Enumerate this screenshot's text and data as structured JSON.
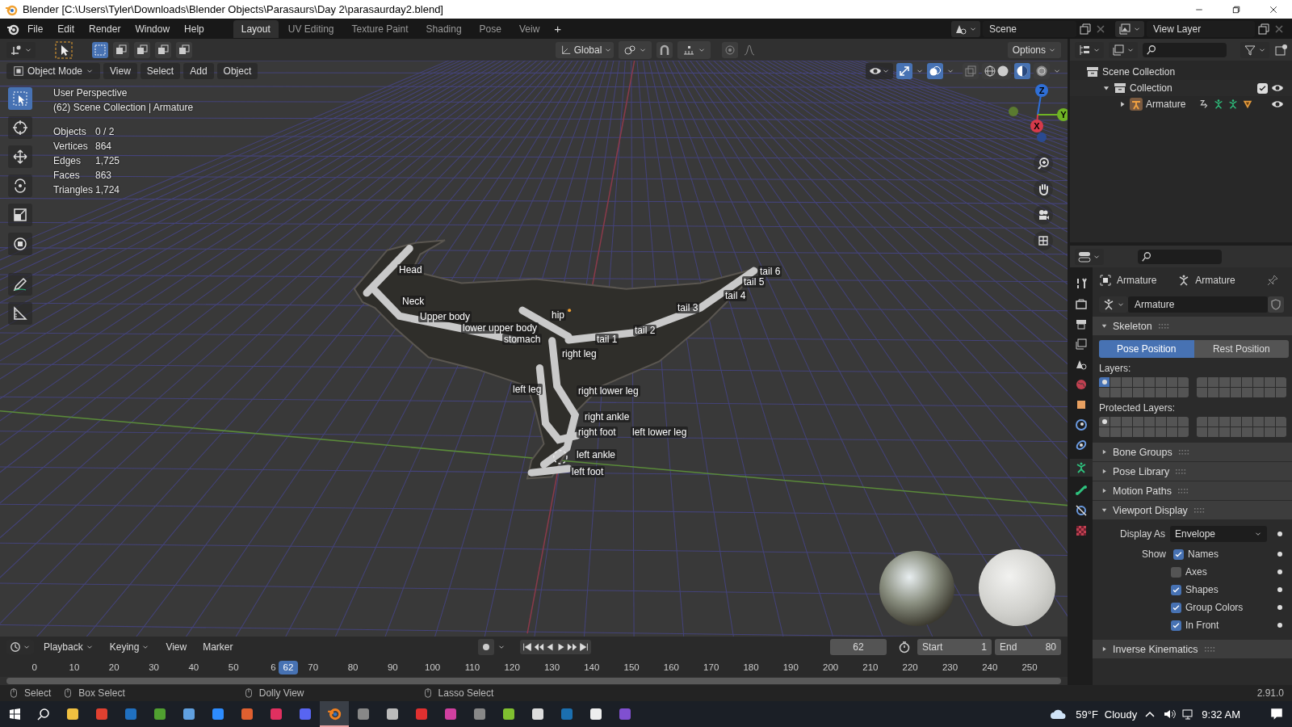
{
  "window": {
    "title": "Blender [C:\\Users\\Tyler\\Downloads\\Blender Objects\\Parasaurs\\Day 2\\parasaurday2.blend]"
  },
  "menu": [
    "File",
    "Edit",
    "Render",
    "Window",
    "Help"
  ],
  "workspaces": [
    {
      "label": "Layout",
      "selected": true
    },
    {
      "label": "UV Editing",
      "selected": false
    },
    {
      "label": "Texture Paint",
      "selected": false
    },
    {
      "label": "Shading",
      "selected": false
    },
    {
      "label": "Pose",
      "selected": false
    },
    {
      "label": "Veiw",
      "selected": false
    }
  ],
  "add_workspace": "+",
  "scene": "Scene",
  "view_layer": "View Layer",
  "viewport": {
    "orientation": "Global",
    "options": "Options",
    "mode": "Object Mode",
    "menus": [
      "View",
      "Select",
      "Add",
      "Object"
    ],
    "info": [
      "User Perspective",
      "(62) Scene Collection | Armature"
    ],
    "stats": [
      {
        "label": "Objects",
        "value": "0 / 2"
      },
      {
        "label": "Vertices",
        "value": "864"
      },
      {
        "label": "Edges",
        "value": "1,725"
      },
      {
        "label": "Faces",
        "value": "863"
      },
      {
        "label": "Triangles",
        "value": "1,724"
      }
    ],
    "gizmo_axes": [
      {
        "label": "Z",
        "color": "#2f6fd6"
      },
      {
        "label": "Y",
        "color": "#6fb324"
      },
      {
        "label": "X",
        "color": "#d63a4a"
      }
    ],
    "bones": [
      {
        "name": "Head"
      },
      {
        "name": "Neck"
      },
      {
        "name": "Upper body"
      },
      {
        "name": "lower upper body"
      },
      {
        "name": "stomach"
      },
      {
        "name": "hip"
      },
      {
        "name": "tail 1"
      },
      {
        "name": "tail 2"
      },
      {
        "name": "tail 3"
      },
      {
        "name": "tail 4"
      },
      {
        "name": "tail 5"
      },
      {
        "name": "tail 6"
      },
      {
        "name": "right leg"
      },
      {
        "name": "left leg"
      },
      {
        "name": "right lower leg"
      },
      {
        "name": "right ankle"
      },
      {
        "name": "right foot"
      },
      {
        "name": "left lower leg"
      },
      {
        "name": "left ankle"
      },
      {
        "name": "left foot"
      }
    ]
  },
  "timeline": {
    "menus": [
      "Playback",
      "Keying",
      "View",
      "Marker"
    ],
    "current_frame": "62",
    "playhead_frame": "62",
    "start_label": "Start",
    "start": "1",
    "end_label": "End",
    "end": "80",
    "ticks": [
      "0",
      "10",
      "20",
      "30",
      "40",
      "50",
      "6",
      "70",
      "80",
      "90",
      "100",
      "110",
      "120",
      "130",
      "140",
      "150",
      "160",
      "170",
      "180",
      "190",
      "200",
      "210",
      "220",
      "230",
      "240",
      "250"
    ]
  },
  "outliner": {
    "items": [
      {
        "label": "Scene Collection",
        "children": [
          {
            "label": "Collection",
            "expanded": true,
            "checked": true,
            "children": [
              {
                "label": "Armature",
                "expanded": false
              }
            ]
          }
        ]
      }
    ]
  },
  "properties": {
    "breadcrumb": [
      "Armature",
      "Armature"
    ],
    "data_name": "Armature",
    "panels": [
      {
        "kind": "skeleton",
        "title": "Skeleton",
        "expanded": true,
        "positions": [
          {
            "label": "Pose Position",
            "selected": true
          },
          {
            "label": "Rest Position",
            "selected": false
          }
        ],
        "layers_label": "Layers:",
        "layers": [
          {
            "selected": true,
            "has_bones": true
          },
          {
            "selected": false,
            "has_bones": false
          },
          {
            "selected": false,
            "has_bones": false
          },
          {
            "selected": false,
            "has_bones": false
          },
          {
            "selected": false,
            "has_bones": false
          },
          {
            "selected": false,
            "has_bones": false
          },
          {
            "selected": false,
            "has_bones": false
          },
          {
            "selected": false,
            "has_bones": false
          },
          {
            "selected": false,
            "has_bones": false
          },
          {
            "selected": false,
            "has_bones": false
          },
          {
            "selected": false,
            "has_bones": false
          },
          {
            "selected": false,
            "has_bones": false
          },
          {
            "selected": false,
            "has_bones": false
          },
          {
            "selected": false,
            "has_bones": false
          },
          {
            "selected": false,
            "has_bones": false
          },
          {
            "selected": false,
            "has_bones": false
          },
          {
            "selected": false,
            "has_bones": false
          },
          {
            "selected": false,
            "has_bones": false
          },
          {
            "selected": false,
            "has_bones": false
          },
          {
            "selected": false,
            "has_bones": false
          },
          {
            "selected": false,
            "has_bones": false
          },
          {
            "selected": false,
            "has_bones": false
          },
          {
            "selected": false,
            "has_bones": false
          },
          {
            "selected": false,
            "has_bones": false
          },
          {
            "selected": false,
            "has_bones": false
          },
          {
            "selected": false,
            "has_bones": false
          },
          {
            "selected": false,
            "has_bones": false
          },
          {
            "selected": false,
            "has_bones": false
          },
          {
            "selected": false,
            "has_bones": false
          },
          {
            "selected": false,
            "has_bones": false
          },
          {
            "selected": false,
            "has_bones": false
          },
          {
            "selected": false,
            "has_bones": false
          }
        ],
        "protected_label": "Protected Layers:",
        "protected_layers": [
          {
            "selected": false,
            "has_bones": true
          },
          {
            "selected": false,
            "has_bones": false
          },
          {
            "selected": false,
            "has_bones": false
          },
          {
            "selected": false,
            "has_bones": false
          },
          {
            "selected": false,
            "has_bones": false
          },
          {
            "selected": false,
            "has_bones": false
          },
          {
            "selected": false,
            "has_bones": false
          },
          {
            "selected": false,
            "has_bones": false
          },
          {
            "selected": false,
            "has_bones": false
          },
          {
            "selected": false,
            "has_bones": false
          },
          {
            "selected": false,
            "has_bones": false
          },
          {
            "selected": false,
            "has_bones": false
          },
          {
            "selected": false,
            "has_bones": false
          },
          {
            "selected": false,
            "has_bones": false
          },
          {
            "selected": false,
            "has_bones": false
          },
          {
            "selected": false,
            "has_bones": false
          },
          {
            "selected": false,
            "has_bones": false
          },
          {
            "selected": false,
            "has_bones": false
          },
          {
            "selected": false,
            "has_bones": false
          },
          {
            "selected": false,
            "has_bones": false
          },
          {
            "selected": false,
            "has_bones": false
          },
          {
            "selected": false,
            "has_bones": false
          },
          {
            "selected": false,
            "has_bones": false
          },
          {
            "selected": false,
            "has_bones": false
          },
          {
            "selected": false,
            "has_bones": false
          },
          {
            "selected": false,
            "has_bones": false
          },
          {
            "selected": false,
            "has_bones": false
          },
          {
            "selected": false,
            "has_bones": false
          },
          {
            "selected": false,
            "has_bones": false
          },
          {
            "selected": false,
            "has_bones": false
          },
          {
            "selected": false,
            "has_bones": false
          },
          {
            "selected": false,
            "has_bones": false
          }
        ]
      },
      {
        "kind": "plain",
        "title": "Bone Groups",
        "expanded": false
      },
      {
        "kind": "plain",
        "title": "Pose Library",
        "expanded": false
      },
      {
        "kind": "plain",
        "title": "Motion Paths",
        "expanded": false
      },
      {
        "kind": "display",
        "title": "Viewport Display",
        "expanded": true,
        "display_as_label": "Display As",
        "display_as": "Envelope",
        "show_label": "Show",
        "options": [
          {
            "label": "Names",
            "checked": true
          },
          {
            "label": "Axes",
            "checked": false
          },
          {
            "label": "Shapes",
            "checked": true
          },
          {
            "label": "Group Colors",
            "checked": true
          },
          {
            "label": "In Front",
            "checked": true
          }
        ]
      },
      {
        "kind": "plain",
        "title": "Inverse Kinematics",
        "expanded": false
      }
    ]
  },
  "status_bar": {
    "hints": [
      "Select",
      "Box Select",
      "Dolly View",
      "Lasso Select"
    ],
    "version": "2.91.0"
  },
  "taskbar": {
    "temperature": "59°F",
    "weather": "Cloudy",
    "time": "9:32 AM"
  }
}
